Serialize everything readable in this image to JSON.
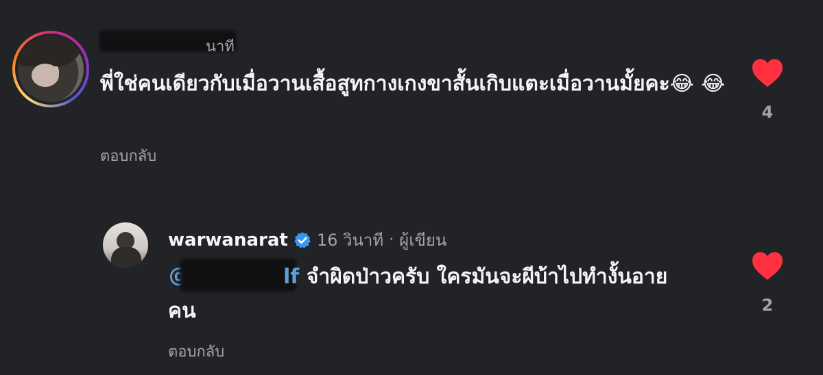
{
  "comment": {
    "username": "",
    "time_suffix": "นาที",
    "text": "พี่ใช่คนเดียวกับเมื่อวานเสื้อสูทกางเกงขาสั้นเกิบแตะเมื่อวานมั้ยคะ😂 😂",
    "reply_label": "ตอบกลับ",
    "likes": "4"
  },
  "reply": {
    "username": "warwanarat",
    "time": "16 วินาที",
    "separator": "·",
    "author_badge": "ผู้เขียน",
    "mention_prefix": "@",
    "mention_suffix": "lf",
    "text": " จำผิดป่าวครับ ใครมันจะผีบ้าไปทำงั้นอายคน",
    "reply_label": "ตอบกลับ",
    "likes": "2"
  },
  "colors": {
    "background": "#222327",
    "heart": "#ff3040",
    "verified": "#3897f0",
    "muted_text": "#a3a3a6"
  }
}
